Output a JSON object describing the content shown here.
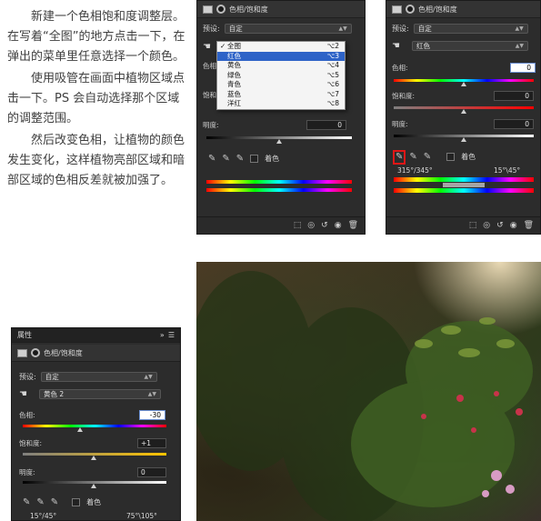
{
  "article": {
    "paragraphs": [
      "新建一个色相饱和度调整层。在写着“全图”的地方点击一下，在弹出的菜单里任意选择一个颜色。",
      "使用吸管在画面中植物区域点击一下。PS 会自动选择那个区域的调整范围。",
      "然后改变色相，让植物的颜色发生变化，这样植物亮部区域和暗部区域的色相反差就被加强了。"
    ]
  },
  "panel_a": {
    "title": "色相/饱和度",
    "preset_label": "预设:",
    "preset_value": "自定",
    "hue_label": "色相",
    "sat_label": "饱和",
    "light_label": "明度:",
    "light_value": "0",
    "colorize_label": "着色",
    "menu": [
      {
        "label": "全图",
        "shortcut": "⌥2",
        "checked": true
      },
      {
        "label": "红色",
        "shortcut": "⌥3",
        "highlighted": true
      },
      {
        "label": "黄色",
        "shortcut": "⌥4"
      },
      {
        "label": "绿色",
        "shortcut": "⌥5"
      },
      {
        "label": "青色",
        "shortcut": "⌥6"
      },
      {
        "label": "蓝色",
        "shortcut": "⌥7"
      },
      {
        "label": "洋红",
        "shortcut": "⌥8"
      }
    ],
    "check_mark": "✓"
  },
  "panel_b": {
    "title": "色相/饱和度",
    "preset_label": "预设:",
    "preset_value": "自定",
    "channel_value": "红色",
    "hue_label": "色相:",
    "hue_value": "0",
    "sat_label": "饱和度:",
    "sat_value": "0",
    "light_label": "明度:",
    "light_value": "0",
    "colorize_label": "着色",
    "range_left": "315°/345°",
    "range_right": "15°\\45°"
  },
  "panel_c": {
    "tab_label": "属性",
    "title": "色相/饱和度",
    "preset_label": "预设:",
    "preset_value": "自定",
    "channel_value": "黄色 2",
    "hue_label": "色相:",
    "hue_value": "-30",
    "sat_label": "饱和度:",
    "sat_value": "+1",
    "light_label": "明度:",
    "light_value": "0",
    "colorize_label": "着色",
    "range_left": "15°/45°",
    "range_right": "75°\\105°"
  },
  "icons": {
    "adjustment": "adjustment-layer-icon",
    "mask": "mask-icon",
    "hand": "target-adjust-hand-icon",
    "eyedropper": "eyedropper-icon",
    "eyedropper_add": "eyedropper-plus-icon",
    "eyedropper_sub": "eyedropper-minus-icon",
    "clip": "clip-to-layer-icon",
    "view_prev": "view-previous-icon",
    "reset": "reset-icon",
    "visibility": "eye-icon",
    "delete": "trash-icon"
  },
  "colors": {
    "panel_bg": "#2c2c2c",
    "highlight": "#2e63c7",
    "selection_outline": "#e01616"
  }
}
